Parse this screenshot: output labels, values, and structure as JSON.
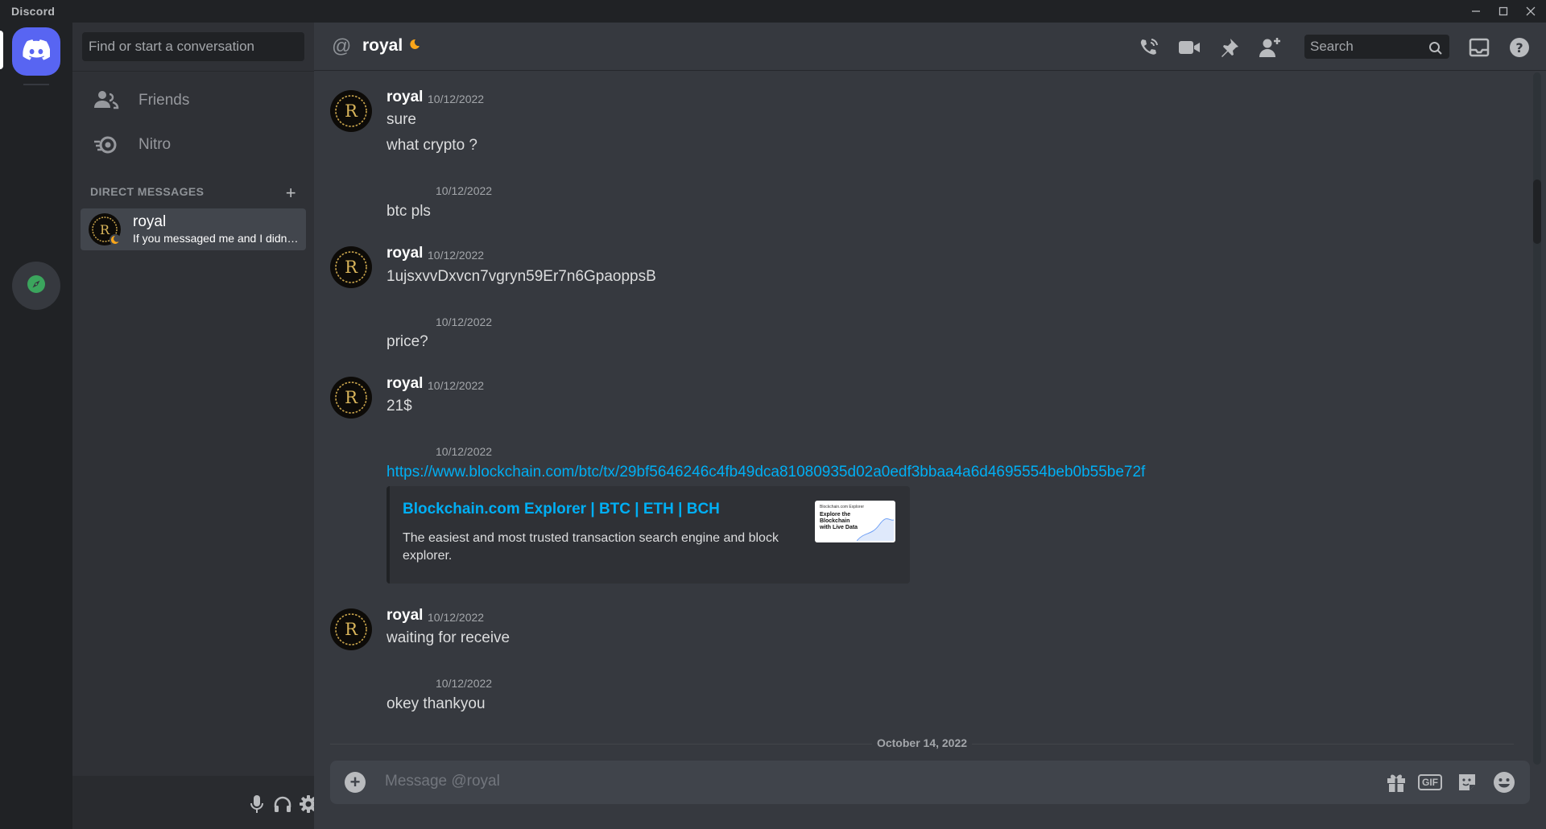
{
  "window": {
    "title": "Discord"
  },
  "sidebar": {
    "find_placeholder": "Find or start a conversation",
    "nav": [
      {
        "label": "Friends",
        "icon": "friends-icon"
      },
      {
        "label": "Nitro",
        "icon": "nitro-icon"
      }
    ],
    "dm_header": "DIRECT MESSAGES",
    "dm_add": "+",
    "dms": [
      {
        "name": "royal",
        "status_text": "If you messaged me and I didn't reply, please send a friend request",
        "status": "idle"
      }
    ]
  },
  "header": {
    "channel_name": "royal",
    "search_placeholder": "Search",
    "icons": [
      "call-icon",
      "video-icon",
      "pin-icon",
      "add-friend-icon",
      "search-icon",
      "inbox-icon",
      "help-icon"
    ]
  },
  "messages": [
    {
      "author": "royal",
      "timestamp": "10/12/2022",
      "lines": [
        "sure",
        "what crypto ?"
      ]
    },
    {
      "author": "",
      "timestamp": "10/12/2022",
      "lines": [
        "btc pls"
      ]
    },
    {
      "author": "royal",
      "timestamp": "10/12/2022",
      "lines": [
        "1ujsxvvDxvcn7vgryn59Er7n6GpaoppsB"
      ]
    },
    {
      "author": "",
      "timestamp": "10/12/2022",
      "lines": [
        "price?"
      ]
    },
    {
      "author": "royal",
      "timestamp": "10/12/2022",
      "lines": [
        "21$"
      ]
    },
    {
      "author": "",
      "timestamp": "10/12/2022",
      "link": "https://www.blockchain.com/btc/tx/29bf5646246c4fb49dca81080935d02a0edf3bbaa4a6d4695554beb0b55be72f",
      "embed": {
        "title": "Blockchain.com Explorer | BTC | ETH | BCH",
        "description": "The easiest and most trusted transaction search engine and block explorer.",
        "thumb_small": "Blockchain.com Explorer",
        "thumb_big": "Explore the Blockchain with Live Data"
      }
    },
    {
      "author": "royal",
      "timestamp": "10/12/2022",
      "lines": [
        "waiting for receive"
      ]
    },
    {
      "author": "",
      "timestamp": "10/12/2022",
      "lines": [
        "okey thankyou"
      ]
    }
  ],
  "date_divider": "October 14, 2022",
  "composer": {
    "placeholder": "Message @royal",
    "gif_label": "GIF",
    "icons": [
      "gift-icon",
      "gif-icon",
      "sticker-icon",
      "emoji-icon"
    ]
  },
  "colors": {
    "blurple": "#5865f2",
    "link": "#00aff4",
    "idle": "#faa61a",
    "explore_green": "#3ba55d"
  }
}
